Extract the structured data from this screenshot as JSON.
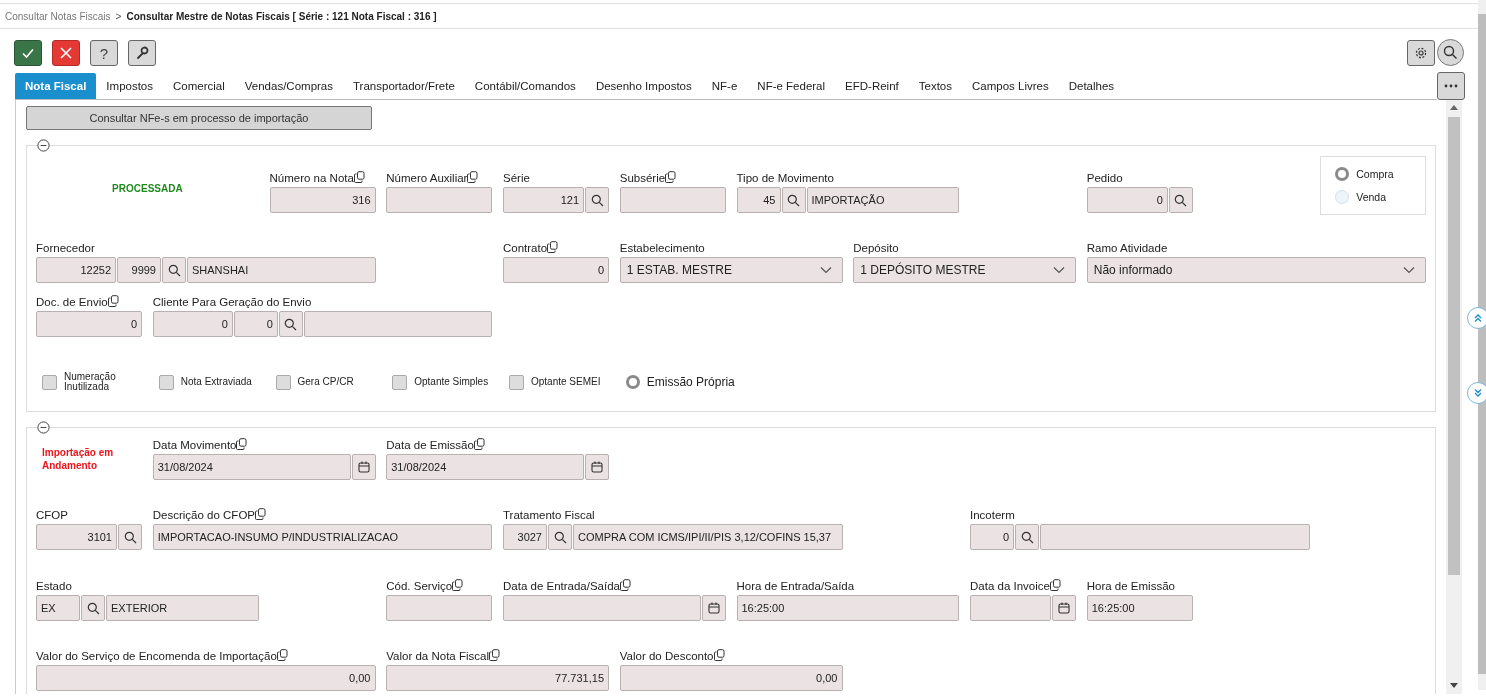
{
  "breadcrumb": {
    "parent": "Consultar Notas Fiscais",
    "separator": ">",
    "current": "Consultar Mestre de Notas Fiscais [ Série : 121 Nota Fiscal : 316 ]"
  },
  "toolbar": [
    {
      "kind": "confirm"
    },
    {
      "kind": "cancel"
    },
    {
      "kind": "help",
      "label": "?"
    },
    {
      "kind": "tools"
    }
  ],
  "tabs": [
    {
      "label": "Nota Fiscal",
      "selected": true
    },
    {
      "label": "Impostos",
      "selected": false
    },
    {
      "label": "Comercial",
      "selected": false
    },
    {
      "label": "Vendas/Compras",
      "selected": false
    },
    {
      "label": "Transportador/Frete",
      "selected": false
    },
    {
      "label": "Contábil/Comandos",
      "selected": false
    },
    {
      "label": "Desenho Impostos",
      "selected": false
    },
    {
      "label": "NF-e",
      "selected": false
    },
    {
      "label": "NF-e Federal",
      "selected": false
    },
    {
      "label": "EFD-Reinf",
      "selected": false
    },
    {
      "label": "Textos",
      "selected": false
    },
    {
      "label": "Campos Livres",
      "selected": false
    },
    {
      "label": "Detalhes",
      "selected": false
    }
  ],
  "import_button": "Consultar NFe-s em processo de importação",
  "sections": [
    {
      "status": {
        "text": "PROCESSADA",
        "kind": "success"
      },
      "choices": [
        {
          "label": "Compra",
          "selected": true
        },
        {
          "label": "Venda",
          "selected": false
        }
      ],
      "fields": [
        {
          "label": "Número na Nota",
          "copy": true,
          "parts": [
            {
              "kind": "number",
              "value": "316"
            }
          ]
        },
        {
          "label": "Número Auxiliar",
          "copy": true,
          "parts": [
            {
              "kind": "text"
            }
          ]
        },
        {
          "label": "Série",
          "copy": false,
          "parts": [
            {
              "kind": "number",
              "value": "121"
            },
            {
              "kind": "search"
            }
          ]
        },
        {
          "label": "Subsérie",
          "copy": true,
          "parts": [
            {
              "kind": "text"
            }
          ]
        },
        {
          "label": "Tipo de Movimento",
          "copy": false,
          "parts": [
            {
              "kind": "number",
              "value": "45"
            },
            {
              "kind": "search"
            },
            {
              "kind": "text",
              "value": "IMPORTAÇÃO"
            }
          ]
        },
        {
          "label": "Pedido",
          "copy": false,
          "parts": [
            {
              "kind": "number",
              "value": "0"
            },
            {
              "kind": "search"
            }
          ]
        },
        {
          "label": "Fornecedor",
          "copy": false,
          "parts": [
            {
              "kind": "number",
              "value": "12252"
            },
            {
              "kind": "number",
              "value": "9999"
            },
            {
              "kind": "search"
            },
            {
              "kind": "text",
              "value": "SHANSHAI"
            }
          ]
        },
        {
          "label": "Contrato",
          "copy": true,
          "parts": [
            {
              "kind": "number",
              "value": "0"
            }
          ]
        },
        {
          "label": "Estabelecimento",
          "copy": false,
          "parts": [
            {
              "kind": "select",
              "value": "1 ESTAB. MESTRE"
            }
          ]
        },
        {
          "label": "Depósito",
          "copy": false,
          "parts": [
            {
              "kind": "select",
              "value": "1 DEPÓSITO MESTRE"
            }
          ]
        },
        {
          "label": "Ramo Atividade",
          "copy": false,
          "parts": [
            {
              "kind": "select",
              "value": "Não informado"
            }
          ]
        },
        {
          "label": "Doc. de Envio",
          "copy": true,
          "parts": [
            {
              "kind": "number",
              "value": "0"
            }
          ]
        },
        {
          "label": "Cliente Para Geração do Envio",
          "copy": false,
          "parts": [
            {
              "kind": "number",
              "value": "0"
            },
            {
              "kind": "number",
              "value": "0"
            },
            {
              "kind": "search"
            },
            {
              "kind": "text"
            }
          ]
        }
      ],
      "options": [
        {
          "kind": "checkbox",
          "label": "Numeração Inutilizada",
          "checked": false
        },
        {
          "kind": "checkbox",
          "label": "Nota Extraviada",
          "checked": false
        },
        {
          "kind": "checkbox",
          "label": "Gera CP/CR",
          "checked": false
        },
        {
          "kind": "checkbox",
          "label": "Optante Simples",
          "checked": false
        },
        {
          "kind": "checkbox",
          "label": "Optante SEMEI",
          "checked": false
        },
        {
          "kind": "radio",
          "label": "Emissão Própria",
          "checked": true
        }
      ]
    },
    {
      "status": {
        "text": "Importação em Andamento",
        "kind": "warning"
      },
      "fields": [
        {
          "label": "Data Movimento",
          "copy": true,
          "parts": [
            {
              "kind": "text",
              "value": "31/08/2024"
            },
            {
              "kind": "calendar"
            }
          ]
        },
        {
          "label": "Data de Emissão",
          "copy": true,
          "parts": [
            {
              "kind": "text",
              "value": "31/08/2024"
            },
            {
              "kind": "calendar"
            }
          ]
        },
        {
          "label": "CFOP",
          "copy": false,
          "parts": [
            {
              "kind": "number",
              "value": "3101"
            },
            {
              "kind": "search"
            }
          ]
        },
        {
          "label": "Descrição do CFOP",
          "copy": true,
          "parts": [
            {
              "kind": "text",
              "value": "IMPORTACAO-INSUMO P/INDUSTRIALIZACAO"
            }
          ]
        },
        {
          "label": "Tratamento Fiscal",
          "copy": false,
          "parts": [
            {
              "kind": "number",
              "value": "3027"
            },
            {
              "kind": "search"
            },
            {
              "kind": "text",
              "value": "COMPRA COM ICMS/IPI/II/PIS 3,12/COFINS 15,37"
            }
          ]
        },
        {
          "label": "Incoterm",
          "copy": false,
          "parts": [
            {
              "kind": "number",
              "value": "0"
            },
            {
              "kind": "search"
            },
            {
              "kind": "text"
            }
          ]
        },
        {
          "label": "Estado",
          "copy": false,
          "parts": [
            {
              "kind": "text",
              "value": "EX"
            },
            {
              "kind": "search"
            },
            {
              "kind": "text",
              "value": "EXTERIOR"
            }
          ]
        },
        {
          "label": "Cód. Serviço",
          "copy": true,
          "parts": [
            {
              "kind": "text"
            }
          ]
        },
        {
          "label": "Data de Entrada/Saída",
          "copy": true,
          "parts": [
            {
              "kind": "text"
            },
            {
              "kind": "calendar"
            }
          ]
        },
        {
          "label": "Hora de Entrada/Saída",
          "copy": false,
          "parts": [
            {
              "kind": "text",
              "value": "16:25:00"
            }
          ]
        },
        {
          "label": "Data da Invoice",
          "copy": true,
          "parts": [
            {
              "kind": "text"
            },
            {
              "kind": "calendar"
            }
          ]
        },
        {
          "label": "Hora de Emissão",
          "copy": false,
          "parts": [
            {
              "kind": "text",
              "value": "16:25:00"
            }
          ]
        },
        {
          "label": "Valor do Serviço de Encomenda de Importação",
          "copy": true,
          "parts": [
            {
              "kind": "number",
              "value": "0,00"
            }
          ]
        },
        {
          "label": "Valor da Nota Fiscal",
          "copy": true,
          "parts": [
            {
              "kind": "number",
              "value": "77.731,15"
            }
          ]
        },
        {
          "label": "Valor do Desconto",
          "copy": true,
          "parts": [
            {
              "kind": "number",
              "value": "0,00"
            }
          ]
        }
      ]
    }
  ]
}
